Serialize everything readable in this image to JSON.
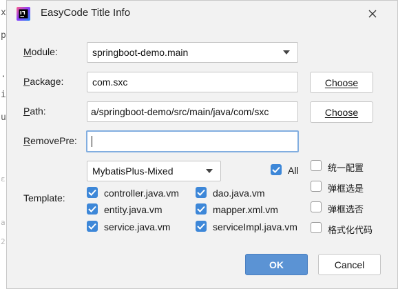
{
  "window": {
    "title": "EasyCode Title Info",
    "icon": "intellij-idea-icon",
    "close_icon": "close-icon"
  },
  "module": {
    "label": "Module:",
    "mnemonic": "M",
    "rest": "odule:",
    "value": "springboot-demo.main"
  },
  "package": {
    "label": "Package:",
    "mnemonic": "P",
    "rest": "ackage:",
    "value": "com.sxc",
    "choose_label": "Choose"
  },
  "path": {
    "label": "Path:",
    "mnemonic": "P",
    "rest": "ath:",
    "value": "a/springboot-demo/src/main/java/com/sxc",
    "choose_label": "Choose"
  },
  "remove_pre": {
    "label": "RemovePre:",
    "mnemonic": "R",
    "rest": "emovePre:",
    "value": ""
  },
  "template": {
    "label": "Template:",
    "group_value": "MybatisPlus-Mixed",
    "all_label": "All",
    "all_checked": true,
    "files": [
      {
        "label": "controller.java.vm",
        "checked": true
      },
      {
        "label": "dao.java.vm",
        "checked": true
      },
      {
        "label": "entity.java.vm",
        "checked": true
      },
      {
        "label": "mapper.xml.vm",
        "checked": true
      },
      {
        "label": "service.java.vm",
        "checked": true
      },
      {
        "label": "serviceImpl.java.vm",
        "checked": true
      }
    ]
  },
  "options": [
    {
      "label": "统一配置",
      "checked": false
    },
    {
      "label": "弹框选是",
      "checked": false
    },
    {
      "label": "弹框选否",
      "checked": false
    },
    {
      "label": "格式化代码",
      "checked": false
    }
  ],
  "buttons": {
    "ok": "OK",
    "cancel": "Cancel"
  },
  "background_editor": {
    "chars": [
      "x",
      "p",
      "·",
      "i",
      "u",
      "ε",
      "a",
      "2"
    ]
  },
  "colors": {
    "accent": "#3d87d8",
    "ok_button": "#5b93d4",
    "focus_border": "#82aee0"
  }
}
